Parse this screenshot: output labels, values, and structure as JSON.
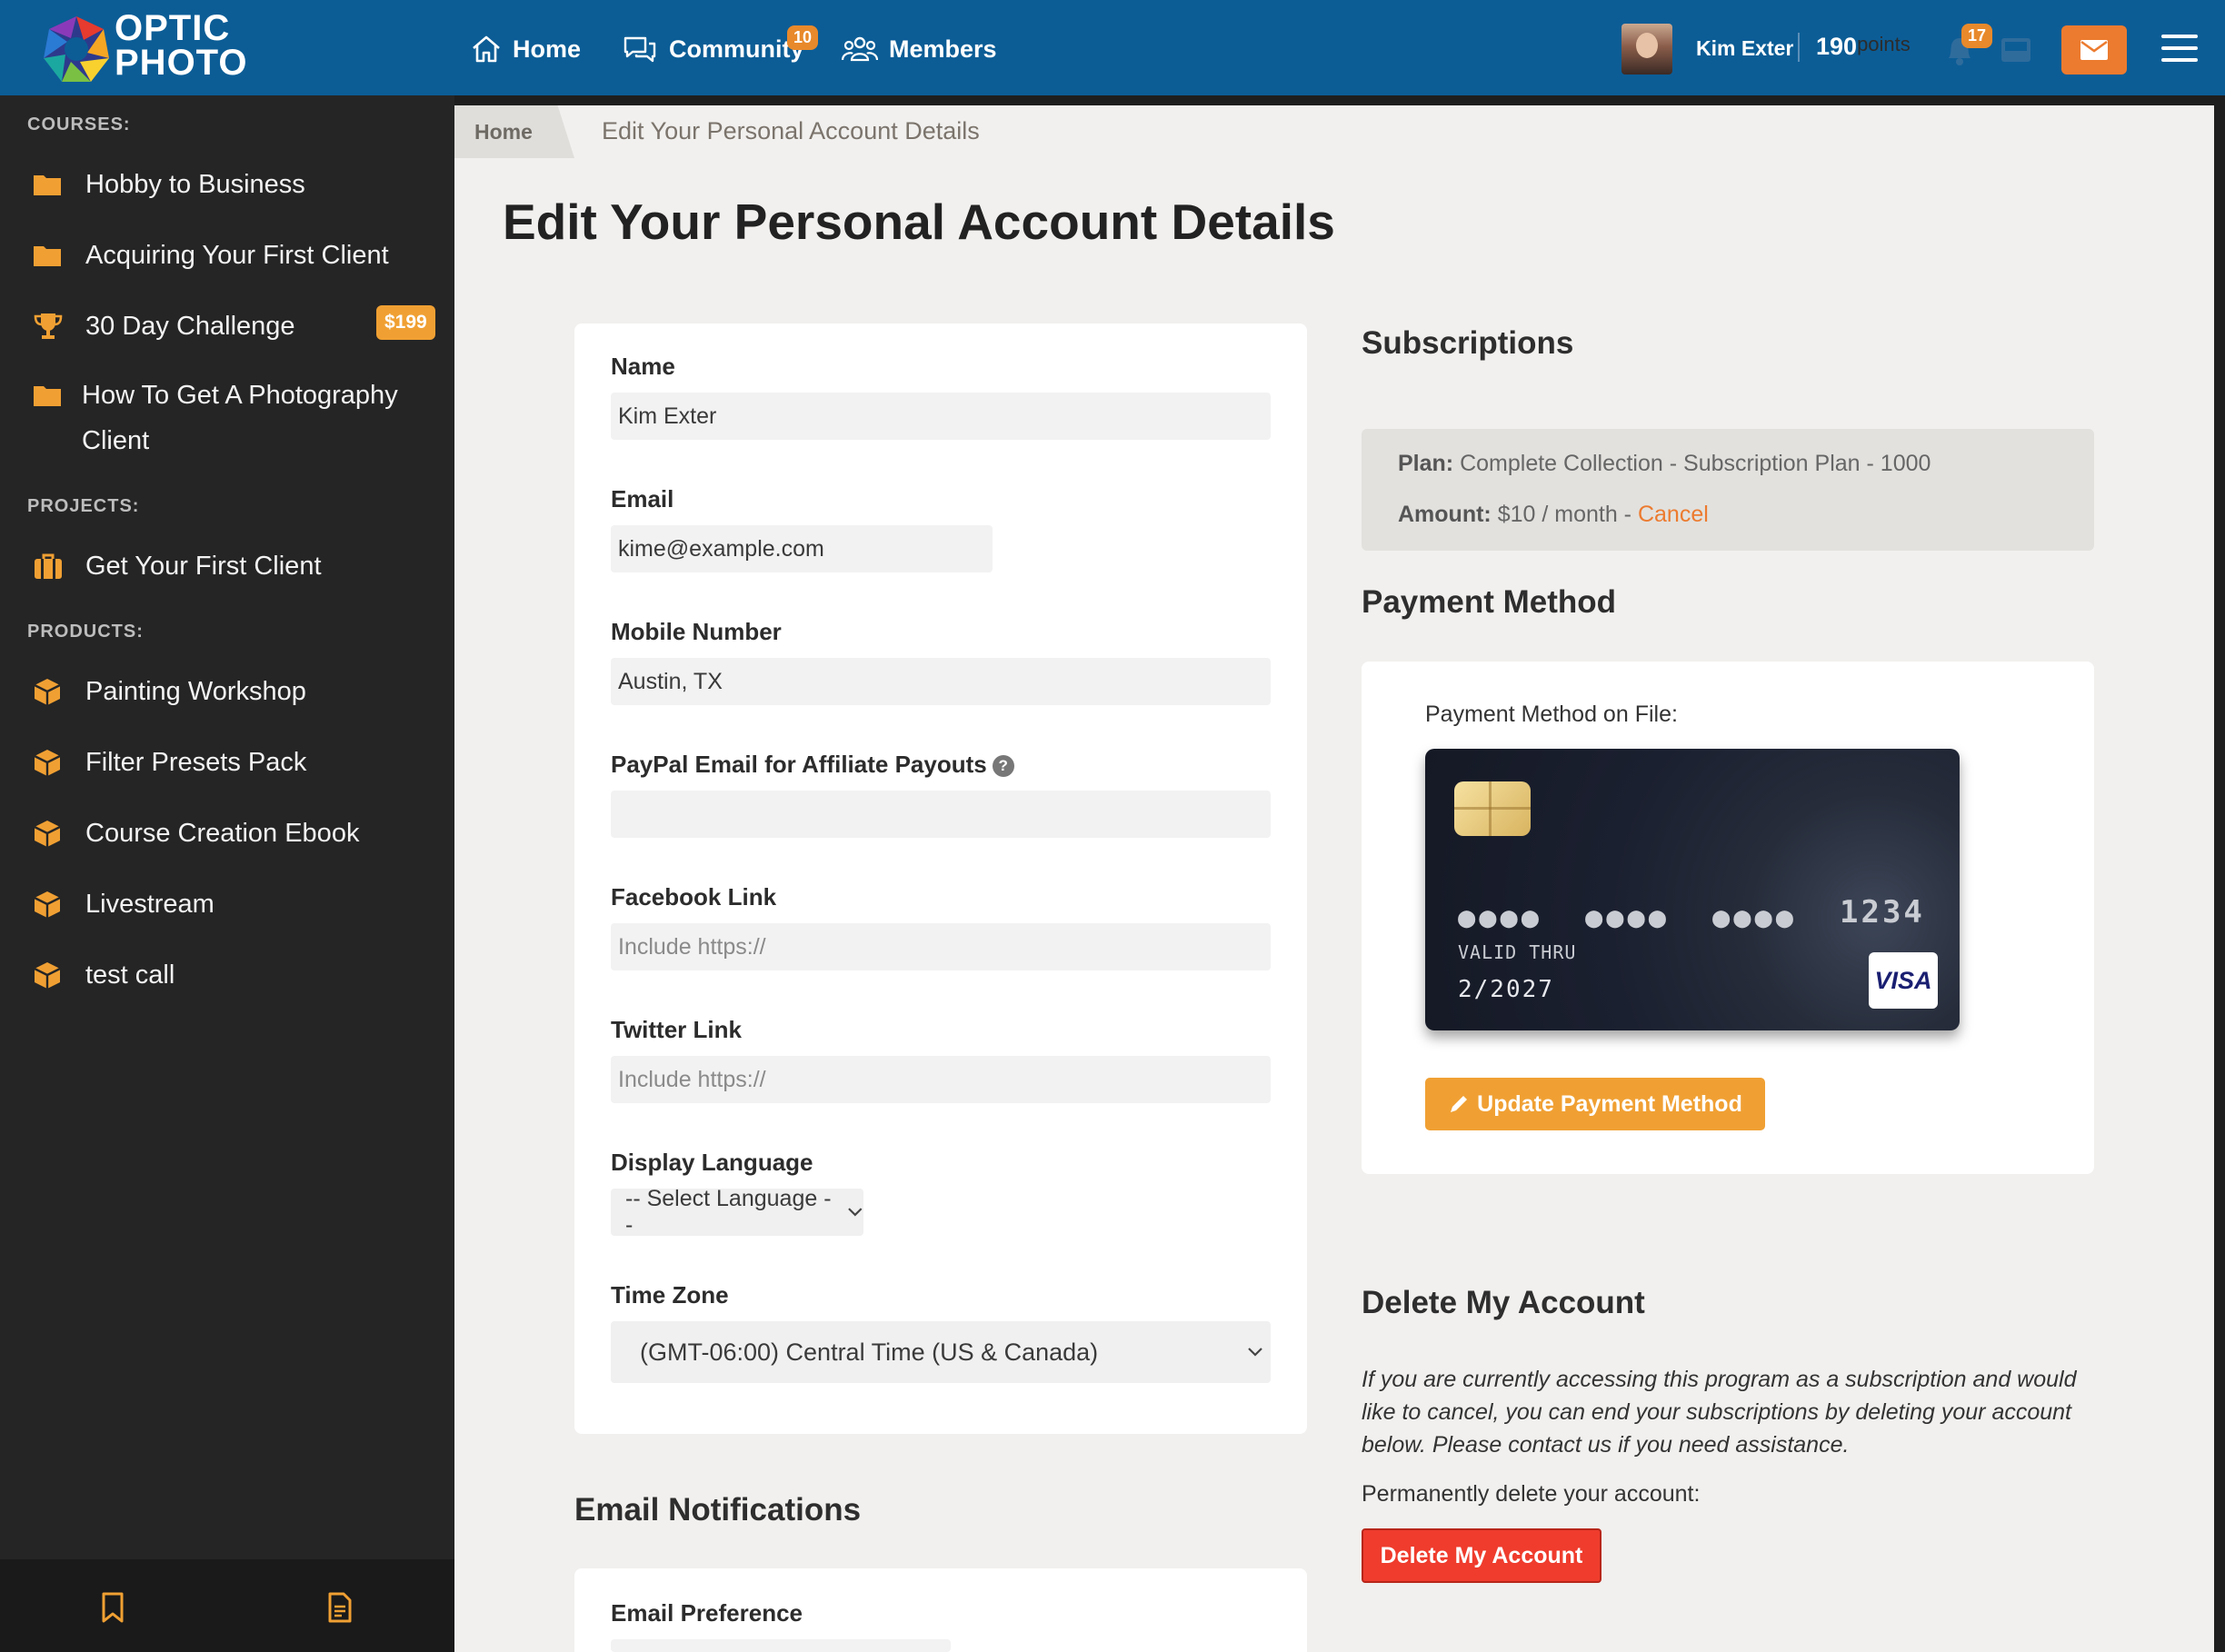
{
  "brand": {
    "line1": "OPTIC",
    "line2": "PHOTO"
  },
  "nav": [
    {
      "label": "Home",
      "icon": "home-icon"
    },
    {
      "label": "Community",
      "icon": "chat-icon",
      "badge": "10"
    },
    {
      "label": "Members",
      "icon": "members-icon"
    }
  ],
  "user": {
    "name": "Kim Exter",
    "points": "190",
    "points_label": "points",
    "notifications": "17"
  },
  "sidebar": {
    "courses_heading": "COURSES:",
    "courses": [
      {
        "label": "Hobby to Business",
        "icon": "folder-icon"
      },
      {
        "label": "Acquiring Your First Client",
        "icon": "folder-icon"
      },
      {
        "label": "30 Day Challenge",
        "icon": "trophy-icon",
        "badge": "$199"
      },
      {
        "label": "How To Get A Photography Client",
        "icon": "folder-icon"
      }
    ],
    "projects_heading": "PROJECTS:",
    "projects": [
      {
        "label": "Get Your First Client",
        "icon": "briefcase-icon"
      }
    ],
    "products_heading": "PRODUCTS:",
    "products": [
      {
        "label": "Painting Workshop",
        "icon": "box-icon"
      },
      {
        "label": "Filter Presets Pack",
        "icon": "box-icon"
      },
      {
        "label": "Course Creation Ebook",
        "icon": "box-icon"
      },
      {
        "label": "Livestream",
        "icon": "box-icon"
      },
      {
        "label": "test call",
        "icon": "box-icon"
      }
    ]
  },
  "breadcrumb": {
    "home": "Home",
    "current": "Edit Your Personal Account Details"
  },
  "page_title": "Edit Your Personal Account Details",
  "form": {
    "name_label": "Name",
    "name_value": "Kim Exter",
    "email_label": "Email",
    "email_value": "kime@example.com",
    "mobile_label": "Mobile Number",
    "mobile_value": "Austin, TX",
    "paypal_label": "PayPal Email for Affiliate Payouts",
    "paypal_value": "",
    "facebook_label": "Facebook Link",
    "facebook_placeholder": "Include https://",
    "twitter_label": "Twitter Link",
    "twitter_placeholder": "Include https://",
    "language_label": "Display Language",
    "language_value": "-- Select Language --",
    "timezone_label": "Time Zone",
    "timezone_value": "(GMT-06:00) Central Time (US & Canada)"
  },
  "email_notifications": {
    "title": "Email Notifications",
    "preference_label": "Email Preference"
  },
  "subscriptions": {
    "title": "Subscriptions",
    "plan_label": "Plan:",
    "plan_value": "Complete Collection - Subscription Plan - 1000",
    "amount_label": "Amount:",
    "amount_value": "$10 / month - ",
    "cancel_label": "Cancel"
  },
  "payment": {
    "title": "Payment Method",
    "on_file_label": "Payment Method on File:",
    "card_dots": "●●●●",
    "card_last4": "1234",
    "valid_thru_label": "VALID THRU",
    "expiry": "2/2027",
    "brand": "VISA",
    "update_button": "Update Payment Method"
  },
  "delete_account": {
    "title": "Delete My Account",
    "text": "If you are currently accessing this program as a subscription and would like to cancel, you can end your subscriptions by deleting your account below. Please contact us if you need assistance.",
    "perm_label": "Permanently delete your account:",
    "button": "Delete My Account"
  },
  "colors": {
    "topbar": "#0c5d96",
    "accent": "#f0a033",
    "danger": "#ef3c2d",
    "sidebar": "#252525"
  }
}
